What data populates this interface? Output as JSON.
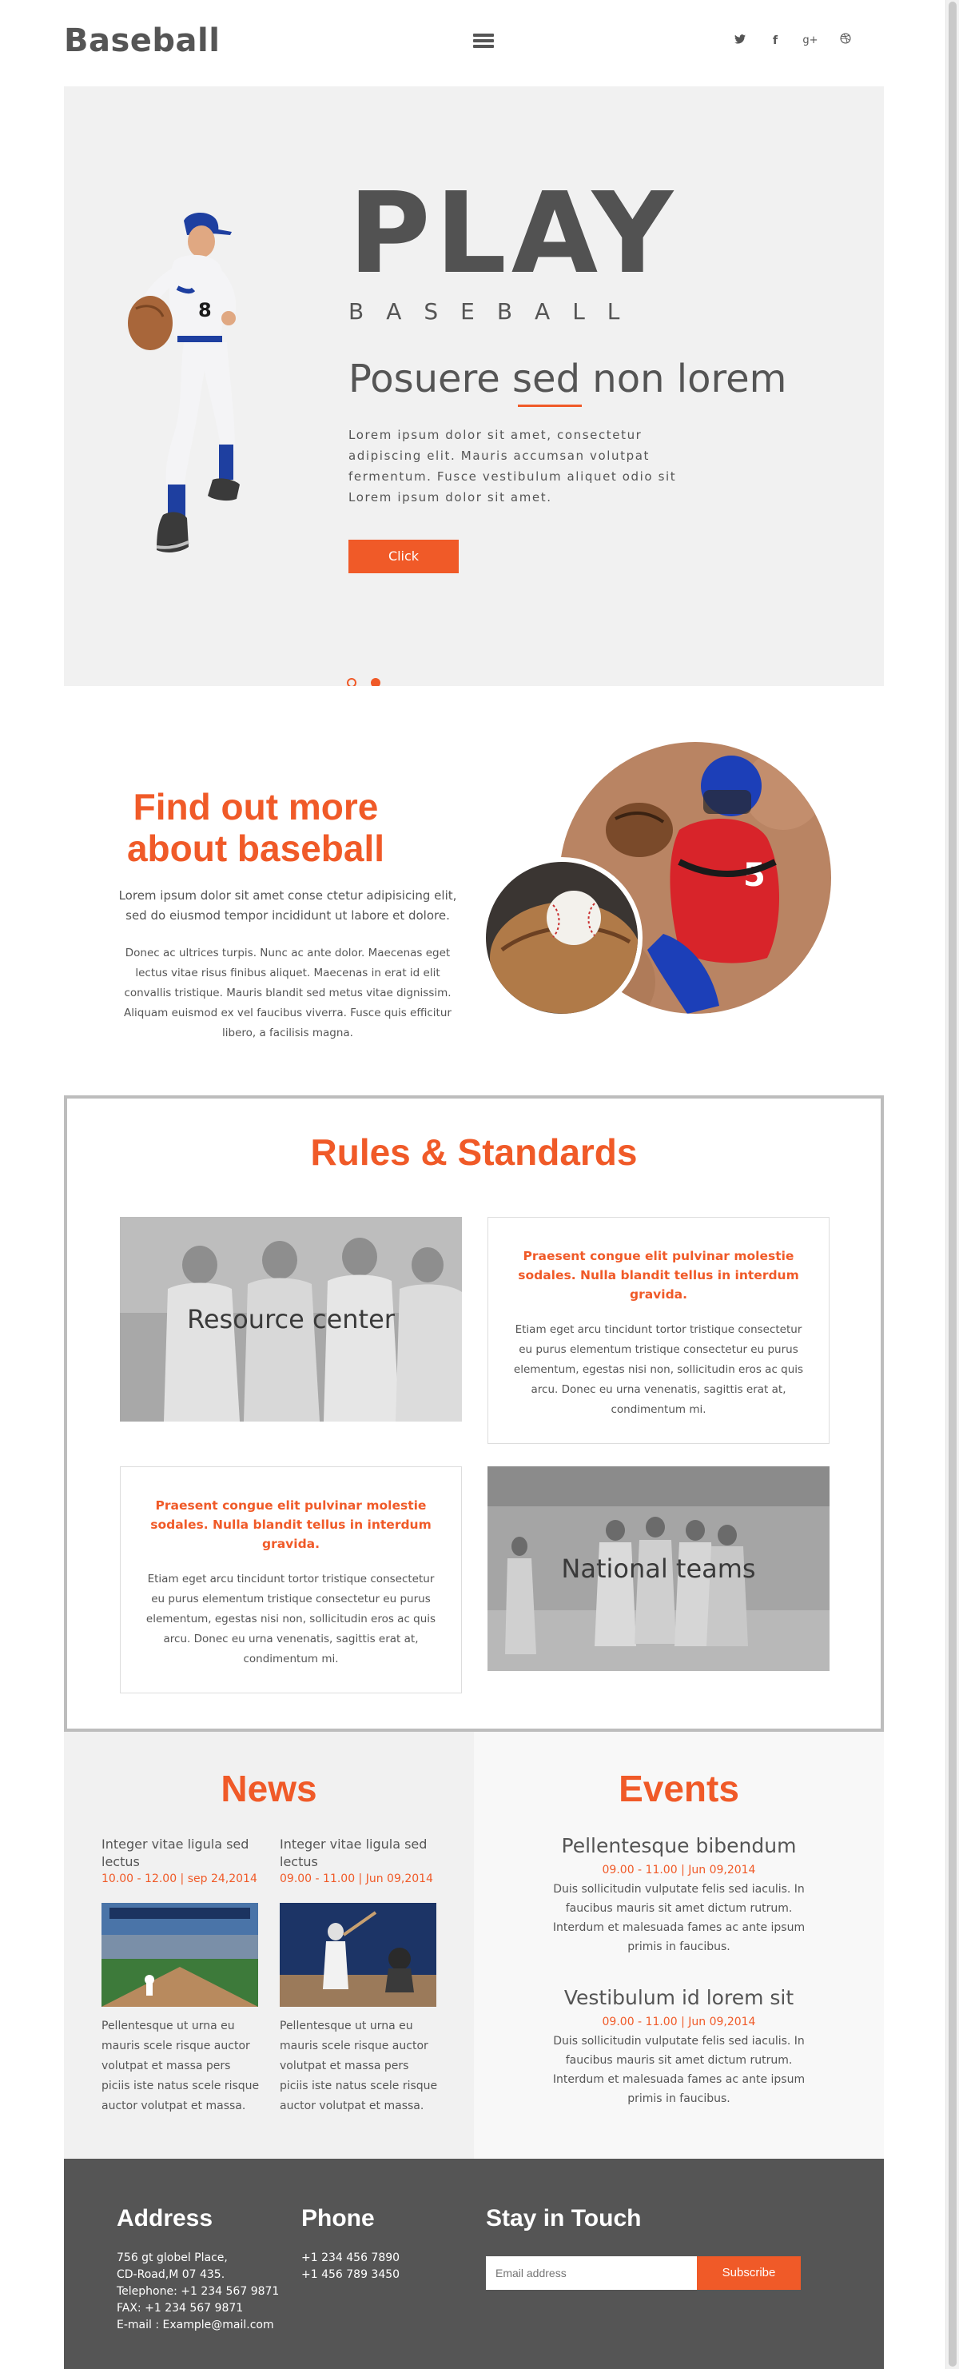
{
  "header": {
    "logo": "Baseball",
    "social": [
      {
        "name": "twitter-icon",
        "glyph": "🐦"
      },
      {
        "name": "facebook-icon",
        "glyph": "f"
      },
      {
        "name": "google-plus-icon",
        "glyph": "g+"
      },
      {
        "name": "dribbble-icon",
        "glyph": "◎"
      }
    ]
  },
  "hero": {
    "title": "PLAY",
    "subtitle": "BASEBALL",
    "heading": "Posuere sed non lorem",
    "text": "Lorem ipsum dolor sit amet, consectetur adipiscing elit. Mauris accumsan volutpat fermentum. Fusce vestibulum aliquet odio sit Lorem ipsum dolor sit amet.",
    "button": "Click"
  },
  "find": {
    "heading": "Find out more about baseball",
    "lead": "Lorem ipsum dolor sit amet conse ctetur adipisicing elit, sed do eiusmod tempor incididunt ut labore et dolore.",
    "text": "Donec ac ultrices turpis. Nunc ac ante dolor. Maecenas eget lectus vitae risus finibus aliquet. Maecenas in erat id elit convallis tristique. Mauris blandit sed metus vitae dignissim. Aliquam euismod ex vel faucibus viverra. Fusce quis efficitur libero, a facilisis magna."
  },
  "rules": {
    "heading": "Rules & Standards",
    "tiles": [
      "Resource center",
      "National teams"
    ],
    "cards": [
      {
        "title": "Praesent congue elit pulvinar molestie sodales. Nulla blandit tellus in interdum gravida.",
        "text": "Etiam eget arcu tincidunt tortor tristique consectetur eu purus elementum tristique consectetur eu purus elementum, egestas nisi non, sollicitudin eros ac quis arcu. Donec eu urna venenatis, sagittis erat at, condimentum mi."
      },
      {
        "title": "Praesent congue elit pulvinar molestie sodales. Nulla blandit tellus in interdum gravida.",
        "text": "Etiam eget arcu tincidunt tortor tristique consectetur eu purus elementum tristique consectetur eu purus elementum, egestas nisi non, sollicitudin eros ac quis arcu. Donec eu urna venenatis, sagittis erat at, condimentum mi."
      }
    ]
  },
  "news": {
    "heading": "News",
    "items": [
      {
        "title": "Integer vitae ligula sed lectus",
        "meta": "10.00 - 12.00 | sep 24,2014",
        "text": "Pellentesque ut urna eu mauris scele risque auctor volutpat et massa pers piciis iste natus scele risque auctor volutpat et massa."
      },
      {
        "title": "Integer vitae ligula sed lectus",
        "meta": "09.00 - 11.00 | Jun 09,2014",
        "text": "Pellentesque ut urna eu mauris scele risque auctor volutpat et massa pers piciis iste natus scele risque auctor volutpat et massa."
      }
    ]
  },
  "events": {
    "heading": "Events",
    "items": [
      {
        "title": "Pellentesque bibendum",
        "meta": "09.00 - 11.00 | Jun 09,2014",
        "text": "Duis sollicitudin vulputate felis sed iaculis. In faucibus mauris sit amet dictum rutrum. Interdum et malesuada fames ac ante ipsum primis in faucibus."
      },
      {
        "title": "Vestibulum id lorem sit",
        "meta": "09.00 - 11.00 | Jun 09,2014",
        "text": "Duis sollicitudin vulputate felis sed iaculis. In faucibus mauris sit amet dictum rutrum. Interdum et malesuada fames ac ante ipsum primis in faucibus."
      }
    ]
  },
  "footer": {
    "address_title": "Address",
    "address_lines": [
      "756 gt globel Place,",
      "CD-Road,M 07 435.",
      "Telephone: +1 234 567 9871",
      "FAX: +1 234 567 9871",
      "E-mail : Example@mail.com"
    ],
    "phone_title": "Phone",
    "phone_lines": [
      "+1 234 456 7890",
      "+1 456 789 3450"
    ],
    "stay_title": "Stay in Touch",
    "email_placeholder": "Email address",
    "subscribe": "Subscribe"
  },
  "colors": {
    "accent": "#f05a28",
    "dark": "#555555",
    "light_bg": "#f1f1f1"
  }
}
